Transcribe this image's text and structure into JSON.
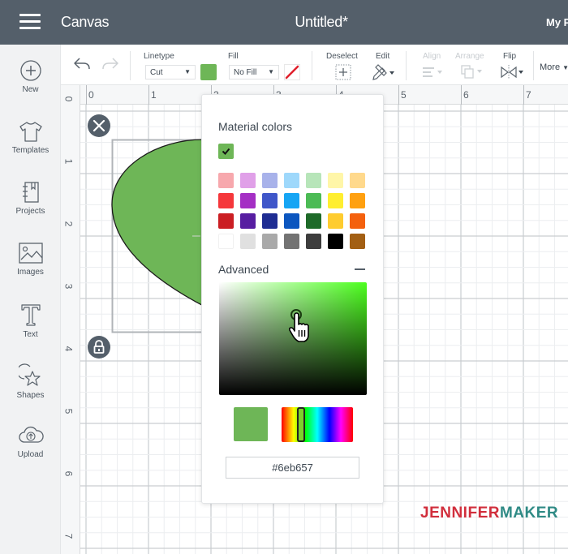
{
  "header": {
    "app_title": "Canvas",
    "doc_title": "Untitled*",
    "my_projects": "My Projects"
  },
  "toolbar": {
    "linetype_label": "Linetype",
    "linetype_value": "Cut",
    "linetype_color": "#6eb657",
    "fill_label": "Fill",
    "fill_value": "No Fill",
    "deselect_label": "Deselect",
    "edit_label": "Edit",
    "align_label": "Align",
    "arrange_label": "Arrange",
    "flip_label": "Flip",
    "more_label": "More",
    "caret": "▼"
  },
  "sidebar": {
    "items": [
      {
        "label": "New",
        "icon": "plus-circle-icon"
      },
      {
        "label": "Templates",
        "icon": "tshirt-icon"
      },
      {
        "label": "Projects",
        "icon": "notebook-icon"
      },
      {
        "label": "Images",
        "icon": "image-icon"
      },
      {
        "label": "Text",
        "icon": "text-t-icon"
      },
      {
        "label": "Shapes",
        "icon": "shapes-icon"
      },
      {
        "label": "Upload",
        "icon": "cloud-upload-icon"
      }
    ]
  },
  "canvas": {
    "ruler_top": [
      "0",
      "1",
      "2",
      "3",
      "4",
      "5",
      "6",
      "7"
    ],
    "ruler_left": [
      "0",
      "1",
      "2",
      "3",
      "4",
      "5",
      "6",
      "7"
    ],
    "shape_fill": "#6eb657"
  },
  "color_picker": {
    "material_title": "Material colors",
    "selected_color": "#6eb657",
    "palette": [
      [
        "#f7a8ad",
        "#e0a0e8",
        "#a8b2ea",
        "#9ed8fb",
        "#b7e5b9",
        "#fff6a8",
        "#ffd98c"
      ],
      [
        "#f5373b",
        "#a42fc4",
        "#3f56c9",
        "#16a5f4",
        "#4cbb55",
        "#ffee30",
        "#ffa010"
      ],
      [
        "#cb1e23",
        "#571da1",
        "#1e2c92",
        "#0c56bf",
        "#1e6a29",
        "#fecc2f",
        "#f4610e"
      ],
      [
        "#ffffff",
        "#e0e0e0",
        "#a9a9a9",
        "#737373",
        "#3d3d3d",
        "#000000",
        "#a35f13"
      ]
    ],
    "advanced_title": "Advanced",
    "hex_value": "#6eb657",
    "hue_position": 0.27,
    "saturation": 0.52,
    "brightness": 0.71
  },
  "brand": {
    "part1": "JENNIFER",
    "part2": "MAKER",
    "color1": "#d12e3c",
    "color2": "#2f8a85"
  }
}
